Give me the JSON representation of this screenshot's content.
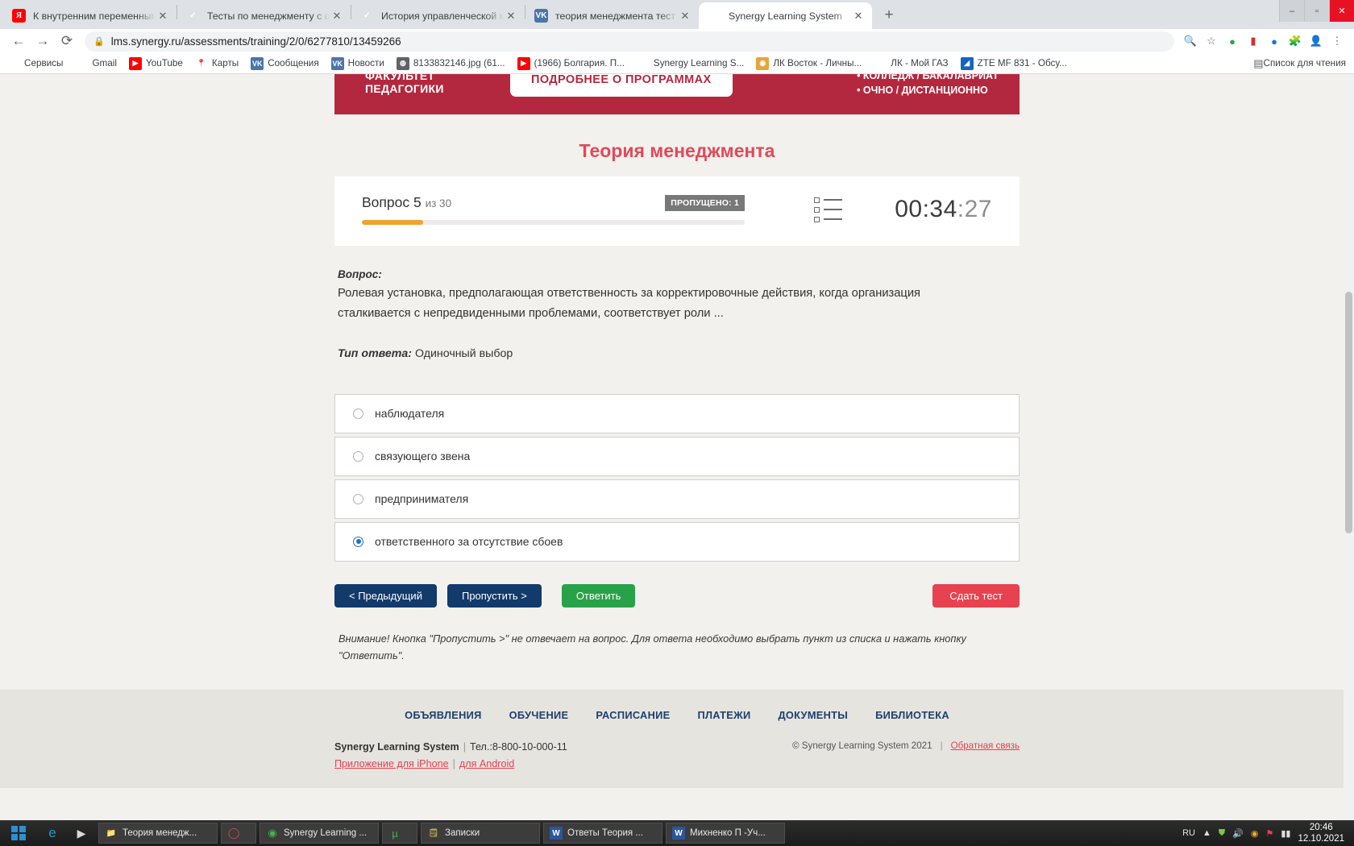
{
  "browser": {
    "tabs": [
      {
        "favicon": "yandex-icon",
        "title": "К внутренним переменным орг",
        "active": false
      },
      {
        "favicon": "check-orange-icon",
        "title": "Тесты по менеджменту с ответа",
        "active": false
      },
      {
        "favicon": "check-blue-icon",
        "title": "История управленческой мысл",
        "active": false
      },
      {
        "favicon": "vk-icon",
        "title": "теория менеджмента тест для с",
        "active": false
      },
      {
        "favicon": "lms-icon",
        "title": "Synergy Learning System",
        "active": true
      }
    ],
    "new_tab_label": "+",
    "window_controls": {
      "minimize": "–",
      "maximize": "▫",
      "close": "✕"
    },
    "nav": {
      "back": "←",
      "forward": "→",
      "reload": "⟳"
    },
    "address": {
      "lock_icon": "lock-icon",
      "url": "lms.synergy.ru/assessments/training/2/0/6277810/13459266"
    },
    "toolbar_icons": [
      "search-icon",
      "star-icon",
      "shield-green-icon",
      "pdf-icon",
      "extension-blue-icon",
      "puzzle-icon",
      "profile-icon",
      "menu-icon"
    ],
    "bookmarks": [
      {
        "icon": "apps-grid-icon",
        "label": "Сервисы"
      },
      {
        "icon": "google-icon",
        "label": "Gmail"
      },
      {
        "icon": "youtube-icon",
        "label": "YouTube"
      },
      {
        "icon": "maps-pin-icon",
        "label": "Карты"
      },
      {
        "icon": "vk-icon",
        "label": "Сообщения"
      },
      {
        "icon": "vk-icon",
        "label": "Новости"
      },
      {
        "icon": "globe-icon",
        "label": "8133832146.jpg (61..."
      },
      {
        "icon": "youtube-icon",
        "label": "(1966) Болгария. П..."
      },
      {
        "icon": "lms-icon",
        "label": "Synergy Learning S..."
      },
      {
        "icon": "east-icon",
        "label": "ЛК Восток - Личны..."
      },
      {
        "icon": "gazprom-icon",
        "label": "ЛК - Мой ГАЗ"
      },
      {
        "icon": "zte-icon",
        "label": "ZTE MF 831 - Обсу..."
      }
    ],
    "reading_list": {
      "icon": "reading-list-icon",
      "label": "Список для чтения"
    }
  },
  "banner": {
    "faculty_line1": "ФАКУЛЬТЕТ",
    "faculty_line2": "ПЕДАГОГИКИ",
    "cta": "ПОДРОБНЕЕ О ПРОГРАММАХ",
    "bullet1": "• КОЛЛЕДЖ / БАКАЛАВРИАТ",
    "bullet2": "• ОЧНО / ДИСТАНЦИОННО"
  },
  "page": {
    "title": "Теория менеджмента"
  },
  "quiz_header": {
    "question_label": "Вопрос 5",
    "question_of": "из 30",
    "skipped_badge": "ПРОПУЩЕНО: 1",
    "progress_percent": 16,
    "list_icon": "question-list-icon",
    "timer_main": "00:34",
    "timer_seconds": ":27"
  },
  "question": {
    "tag": "Вопрос:",
    "text": "Ролевая установка, предполагающая ответственность за корректировочные действия, когда организация сталкивается с непредвиденными проблемами, соответствует роли ...",
    "answer_type_label": "Тип ответа:",
    "answer_type_value": "Одиночный выбор"
  },
  "options": [
    {
      "label": "наблюдателя",
      "selected": false
    },
    {
      "label": "связующего звена",
      "selected": false
    },
    {
      "label": "предпринимателя",
      "selected": false
    },
    {
      "label": "ответственного за отсутствие сбоев",
      "selected": true
    }
  ],
  "actions": {
    "previous": "< Предыдущий",
    "skip": "Пропустить >",
    "answer": "Ответить",
    "submit": "Сдать тест"
  },
  "warning": "Внимание! Кнопка \"Пропустить >\" не отвечает на вопрос. Для ответа необходимо выбрать пункт из списка и нажать кнопку \"Ответить\".",
  "footer": {
    "nav": [
      "ОБЪЯВЛЕНИЯ",
      "ОБУЧЕНИЕ",
      "РАСПИСАНИЕ",
      "ПЛАТЕЖИ",
      "ДОКУМЕНТЫ",
      "БИБЛИОТЕКА"
    ],
    "brand": "Synergy Learning System",
    "phone": "Тел.:8-800-10-000-11",
    "app_iphone": "Приложение для iPhone",
    "app_android": "для Android",
    "copyright": "© Synergy Learning System 2021",
    "feedback": "Обратная связь"
  },
  "taskbar": {
    "start_label": "start-button",
    "quick_launch": [
      "ie-icon",
      "media-player-icon"
    ],
    "apps": [
      {
        "icon": "folder-icon",
        "label": "Теория менедж..."
      },
      {
        "icon": "opera-icon",
        "label": ""
      },
      {
        "icon": "chrome-icon",
        "label": "Synergy Learning ..."
      },
      {
        "icon": "utorrent-icon",
        "label": ""
      },
      {
        "icon": "notes-icon",
        "label": "Записки"
      },
      {
        "icon": "word-icon",
        "label": "Ответы Теория ..."
      },
      {
        "icon": "word-icon",
        "label": "Михненко П -Уч..."
      }
    ],
    "language": "RU",
    "tray_icons": [
      "up-arrow-icon",
      "shield-icon",
      "sound-icon",
      "network-icon",
      "flag-icon",
      "signal-icon"
    ],
    "time": "20:46",
    "date": "12.10.2021"
  }
}
